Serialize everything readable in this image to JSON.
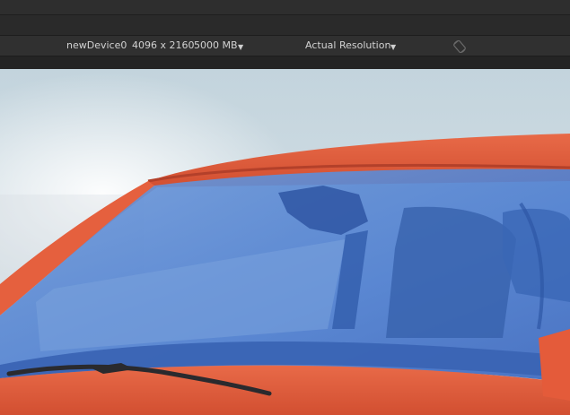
{
  "toolbar": {
    "device_name": "newDevice0",
    "resolution": "4096 x 2160",
    "memory": "5000 MB",
    "memory_dropdown_icon": "caret-down-icon",
    "scale_mode": "Actual Resolution",
    "scale_dropdown_icon": "caret-down-icon",
    "rotate_icon": "rotate-device-icon"
  },
  "viewport": {
    "content": "3D car windshield render with blue highlighted glass"
  },
  "colors": {
    "toolbar_bg": "#303030",
    "car_body": "#e25a3a",
    "glass_highlight": "#3c6fcf",
    "sky": "#c9d7de"
  }
}
